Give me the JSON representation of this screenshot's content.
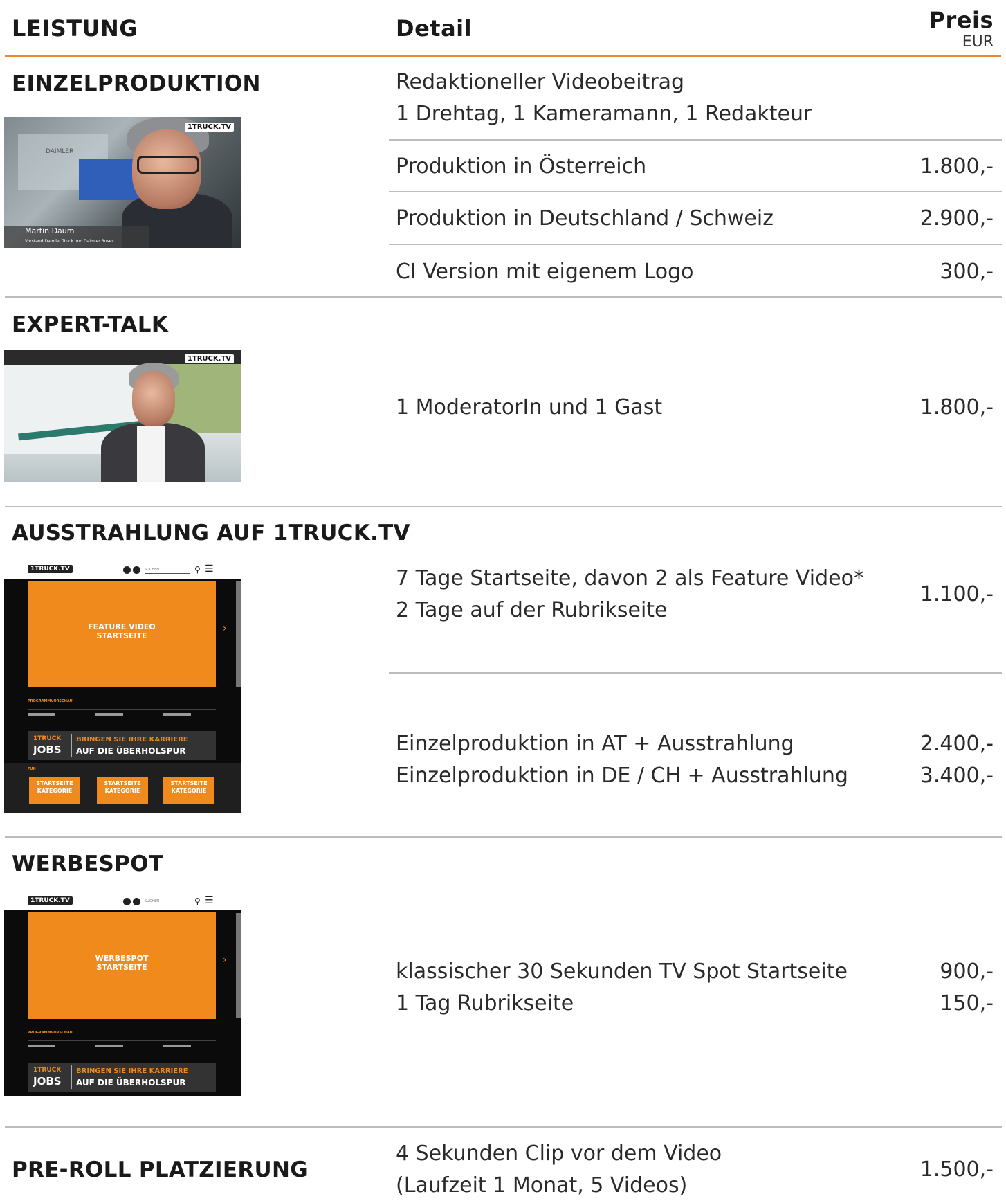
{
  "header": {
    "leistung": "LEISTUNG",
    "detail": "Detail",
    "preis": "Preis",
    "currency": "EUR"
  },
  "sections": {
    "einzelproduktion": {
      "title": "EINZELPRODUKTION",
      "intro": [
        "Redaktioneller Videobeitrag",
        "1 Drehtag, 1 Kameramann, 1 Redakteur"
      ],
      "rows": [
        {
          "detail": "Produktion in Österreich",
          "price": "1.800,-"
        },
        {
          "detail": "Produktion in Deutschland / Schweiz",
          "price": "2.900,-"
        },
        {
          "detail": "CI Version mit eigenem Logo",
          "price": "300,-"
        }
      ],
      "thumb": {
        "logo": "1TRUCK.TV",
        "caption_name": "Martin Daum",
        "caption_role": "Vorstand Daimler Truck und Daimler Buses",
        "brand": "DAIMLER"
      }
    },
    "experttalk": {
      "title": "EXPERT-TALK",
      "detail": "1 ModeratorIn und 1 Gast",
      "price": "1.800,-",
      "thumb": {
        "logo": "1TRUCK.TV"
      }
    },
    "ausstrahlung": {
      "title": "AUSSTRAHLUNG AUF 1TRUCK.TV",
      "lines1": [
        "7 Tage Startseite, davon 2 als Feature Video*",
        "2 Tage auf der Rubrikseite"
      ],
      "price1": "1.100,-",
      "lines2": [
        "Einzelproduktion in AT + Ausstrahlung",
        "Einzelproduktion in DE / CH + Ausstrahlung"
      ],
      "prices2": [
        "2.400,-",
        "3.400,-"
      ],
      "mock": {
        "logo": "1TRUCK.TV",
        "search": "SUCHEN",
        "feature": "FEATURE VIDEO STARTSEITE",
        "program": "PROGRAMMVORSCHAU",
        "jobs_top": "1TRUCK",
        "jobs": "JOBS",
        "career1": "BRINGEN SIE IHRE KARRIERE",
        "career2": "AUF DIE ÜBERHOLSPUR",
        "fun": "FUN",
        "cat": "STARTSEITE KATEGORIE"
      }
    },
    "werbespot": {
      "title": "WERBESPOT",
      "lines": [
        "klassischer 30 Sekunden TV Spot Startseite",
        "1 Tag Rubrikseite"
      ],
      "prices": [
        "900,-",
        "150,-"
      ],
      "mock": {
        "logo": "1TRUCK.TV",
        "search": "SUCHEN",
        "feature": "WERBESPOT STARTSEITE",
        "program": "PROGRAMMVORSCHAU",
        "jobs_top": "1TRUCK",
        "jobs": "JOBS",
        "career1": "BRINGEN SIE IHRE KARRIERE",
        "career2": "AUF DIE ÜBERHOLSPUR"
      }
    },
    "preroll": {
      "title": "PRE-ROLL PLATZIERUNG",
      "lines": [
        "4 Sekunden Clip vor dem Video",
        "(Laufzeit 1 Monat, 5 Videos)"
      ],
      "price": "1.500,-"
    }
  },
  "colors": {
    "accent": "#e8892c",
    "rule": "#bdbdbd"
  }
}
